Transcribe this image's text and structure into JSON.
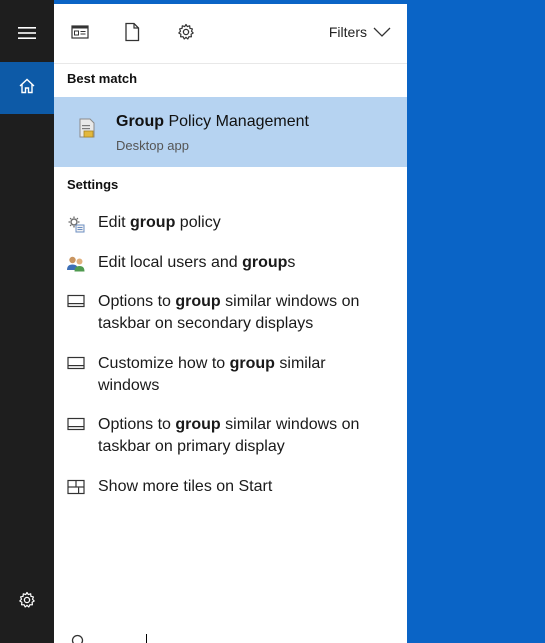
{
  "toolbar": {
    "filters_label": "Filters"
  },
  "best_match": {
    "heading": "Best match",
    "title_bold": "Group",
    "title_rest": " Policy Management",
    "subtitle": "Desktop app"
  },
  "settings": {
    "heading": "Settings",
    "items": [
      {
        "icon": "group-policy-icon",
        "pre": "Edit ",
        "bold": "group",
        "post": " policy"
      },
      {
        "icon": "users-icon",
        "pre": "Edit local users and ",
        "bold": "group",
        "post": "s"
      },
      {
        "icon": "taskbar-icon",
        "pre": "Options to ",
        "bold": "group",
        "post": " similar windows on taskbar on secondary displays"
      },
      {
        "icon": "taskbar-icon",
        "pre": "Customize how to ",
        "bold": "group",
        "post": " similar windows"
      },
      {
        "icon": "taskbar-icon",
        "pre": "Options to ",
        "bold": "group",
        "post": " similar windows on taskbar on primary display"
      },
      {
        "icon": "tiles-icon",
        "pre": "",
        "bold": "",
        "post": "Show more tiles on Start"
      }
    ]
  },
  "colors": {
    "desktop": "#0a64c6",
    "rail": "#1e1e1e",
    "rail_active": "#0d5aa7",
    "highlight": "#b6d3f1"
  }
}
